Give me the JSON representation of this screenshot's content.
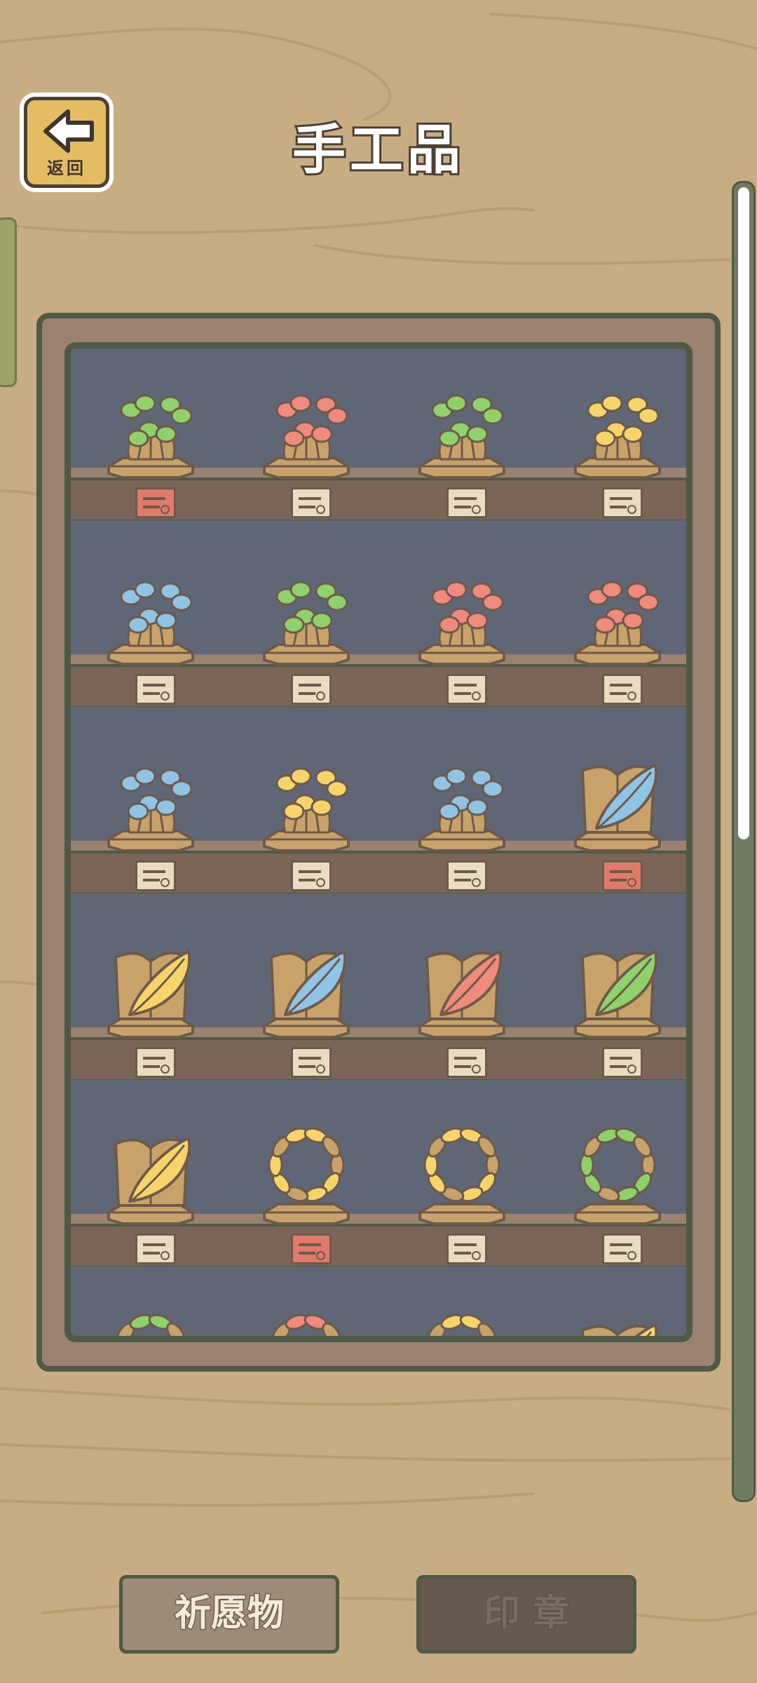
{
  "header": {
    "back_label": "返回",
    "title": "手工品"
  },
  "icons": {
    "back": "left-arrow-icon",
    "tag": "note-tag-icon"
  },
  "colors": {
    "background": "#c9ad82",
    "cabinet": "#9a8170",
    "cabinet_border": "#4e5a45",
    "shelf_back": "#5f6777",
    "tag_default": "#e9dcc0",
    "tag_highlight": "#e07a6a",
    "green": "#8fd16a",
    "red": "#ef8a7c",
    "blue": "#8fc4e6",
    "yellow": "#f6d46a"
  },
  "shelves": [
    {
      "items": [
        {
          "type": "clover-plant",
          "color": "green",
          "tag": "red"
        },
        {
          "type": "clover-plant",
          "color": "red",
          "tag": "default"
        },
        {
          "type": "clover-plant",
          "color": "green",
          "tag": "default"
        },
        {
          "type": "clover-plant",
          "color": "yellow",
          "tag": "default"
        }
      ]
    },
    {
      "items": [
        {
          "type": "clover-plant",
          "color": "blue",
          "tag": "default"
        },
        {
          "type": "clover-plant",
          "color": "green",
          "tag": "default"
        },
        {
          "type": "clover-plant",
          "color": "red",
          "tag": "default"
        },
        {
          "type": "clover-plant",
          "color": "red",
          "tag": "default"
        }
      ]
    },
    {
      "items": [
        {
          "type": "clover-plant",
          "color": "blue",
          "tag": "default"
        },
        {
          "type": "clover-plant",
          "color": "yellow",
          "tag": "default"
        },
        {
          "type": "clover-plant",
          "color": "blue",
          "tag": "default"
        },
        {
          "type": "leaf-book",
          "color": "blue",
          "tag": "red"
        }
      ]
    },
    {
      "items": [
        {
          "type": "leaf-book",
          "color": "yellow",
          "tag": "default"
        },
        {
          "type": "leaf-book",
          "color": "blue",
          "tag": "default"
        },
        {
          "type": "leaf-book",
          "color": "red",
          "tag": "default"
        },
        {
          "type": "leaf-book",
          "color": "green",
          "tag": "default"
        }
      ]
    },
    {
      "items": [
        {
          "type": "leaf-book",
          "color": "yellow",
          "tag": "default"
        },
        {
          "type": "leaf-wreath",
          "color": "yellow",
          "tag": "red"
        },
        {
          "type": "leaf-wreath",
          "color": "yellow",
          "tag": "default"
        },
        {
          "type": "leaf-wreath",
          "color": "green",
          "tag": "default"
        }
      ]
    },
    {
      "items": [
        {
          "type": "leaf-wreath",
          "color": "green",
          "tag": "none"
        },
        {
          "type": "leaf-wreath",
          "color": "red",
          "tag": "none"
        },
        {
          "type": "leaf-wreath",
          "color": "yellow",
          "tag": "none"
        },
        {
          "type": "leaf-book",
          "color": "yellow",
          "tag": "none"
        }
      ]
    }
  ],
  "scroll_position": 0.0,
  "bottom_tabs": {
    "wish": "祈愿物",
    "stamp": "印 章"
  }
}
